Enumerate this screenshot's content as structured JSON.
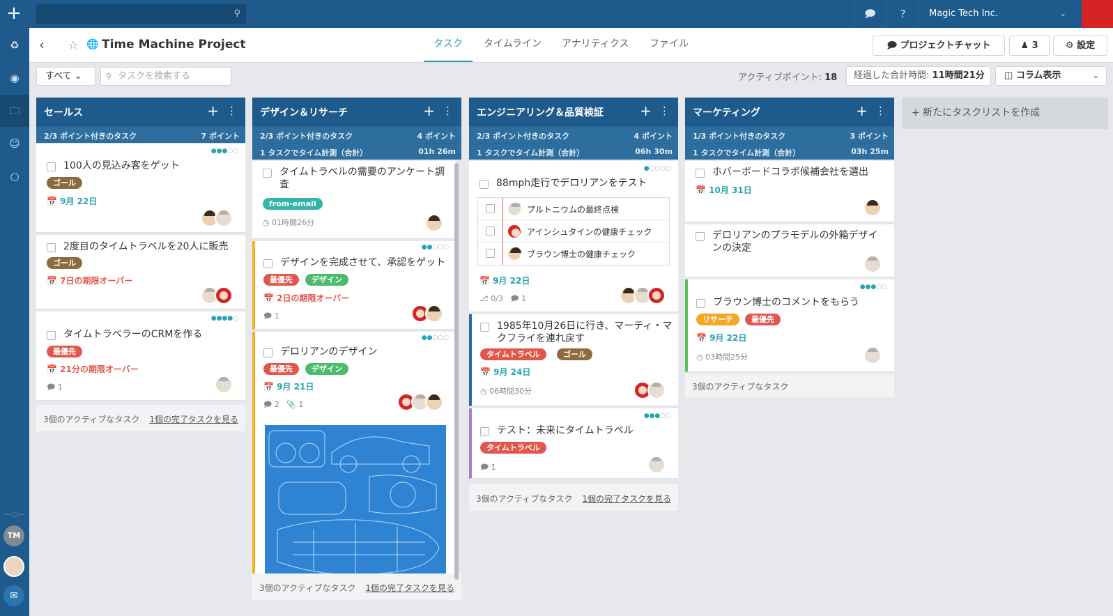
{
  "top": {
    "company": "Magic Tech Inc."
  },
  "sidebar": {
    "user_initials": "TM"
  },
  "project": {
    "title": "Time Machine Project",
    "tabs": [
      "タスク",
      "タイムライン",
      "アナリティクス",
      "ファイル"
    ],
    "chat_button": "プロジェクトチャット",
    "members": "3",
    "settings": "設定"
  },
  "filters": {
    "all": "すべて",
    "search_placeholder": "タスクを検索する",
    "active_points_label": "アクティブポイント:",
    "active_points": "18",
    "elapsed_label": "経過した合計時間:",
    "elapsed_value": "11時間21分",
    "column_view": "コラム表示"
  },
  "new_list": "+ 新たにタスクリストを作成",
  "columns": [
    {
      "title": "セールス",
      "tasks_with_points": "2/3 ポイント付きのタスク",
      "points": "7 ポイント",
      "cards": [
        {
          "title": "100人の見込み客をゲット",
          "tags": [
            "ゴール"
          ],
          "due": "9月 22日"
        },
        {
          "title": "2度目のタイムトラベルを20人に販売",
          "tags": [
            "ゴール"
          ],
          "due": "7日の期限オーバー"
        },
        {
          "title": "タイムトラベラーのCRMを作る",
          "tags": [
            "最優先"
          ],
          "due": "21分の期限オーバー",
          "comments": "1"
        }
      ],
      "footer_active": "3個のアクティブなタスク",
      "footer_link": "1個の完了タスクを見る"
    },
    {
      "title": "デザイン＆リサーチ",
      "tasks_with_points": "2/3 ポイント付きのタスク",
      "points": "4 ポイント",
      "time_label": "1 タスクでタイム計測（合計）",
      "time": "01h 26m",
      "cards": [
        {
          "title": "タイムトラベルの需要のアンケート調査",
          "tags": [
            "from-email"
          ],
          "time": "01時間26分"
        },
        {
          "title": "デザインを完成させて、承認をゲット",
          "tags": [
            "最優先",
            "デザイン"
          ],
          "due": "2日の期限オーバー",
          "comments": "1"
        },
        {
          "title": "デロリアンのデザイン",
          "tags": [
            "最優先",
            "デザイン"
          ],
          "due": "9月 21日",
          "comments": "2",
          "attachments": "1"
        }
      ],
      "footer_active": "3個のアクティブなタスク",
      "footer_link": "1個の完了タスクを見る"
    },
    {
      "title": "エンジニアリング＆品質検証",
      "tasks_with_points": "2/3 ポイント付きのタスク",
      "points": "4 ポイント",
      "time_label": "1 タスクでタイム計測（合計）",
      "time": "06h 30m",
      "cards": [
        {
          "title": "88mph走行でデロリアンをテスト",
          "subtasks": [
            "プルトニウムの最終点検",
            "アインシュタインの健康チェック",
            "ブラウン博士の健康チェック"
          ],
          "due": "9月 22日",
          "subtask_count": "0/3",
          "comments": "1"
        },
        {
          "title": "1985年10月26日に行き、マーティ・マクフライを連れ戻す",
          "tags": [
            "タイムトラベル",
            "ゴール"
          ],
          "due": "9月 24日",
          "time": "06時間30分"
        },
        {
          "title": "テスト：未来にタイムトラベル",
          "tags": [
            "タイムトラベル"
          ],
          "comments": "1"
        }
      ],
      "footer_active": "3個のアクティブなタスク",
      "footer_link": "1個の完了タスクを見る"
    },
    {
      "title": "マーケティング",
      "tasks_with_points": "1/3 ポイント付きのタスク",
      "points": "3 ポイント",
      "time_label": "1 タスクでタイム計測（合計）",
      "time": "03h 25m",
      "cards": [
        {
          "title": "ホバーボードコラボ候補会社を選出",
          "due": "10月 31日"
        },
        {
          "title": "デロリアンのプラモデルの外箱デザインの決定"
        },
        {
          "title": "ブラウン博士のコメントをもらう",
          "tags": [
            "リサーチ",
            "最優先"
          ],
          "due": "9月 22日",
          "time": "03時間25分"
        }
      ],
      "footer_active": "3個のアクティブなタスク"
    }
  ],
  "colors": {
    "nav": "#1e5b8c",
    "accent": "#2aa4b1",
    "danger": "#e2574c"
  }
}
